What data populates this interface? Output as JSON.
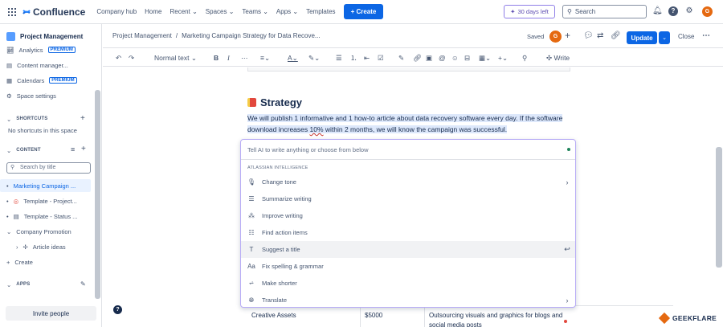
{
  "topbar": {
    "app_name": "Confluence",
    "nav": [
      "Company hub",
      "Home",
      "Recent",
      "Spaces",
      "Teams",
      "Apps",
      "Templates"
    ],
    "create_label": "Create",
    "trial_label": "30 days left",
    "search_placeholder": "Search"
  },
  "sidebar": {
    "space_name": "Project Management",
    "items": [
      {
        "label": "Analytics",
        "badge": "PREMIUM"
      },
      {
        "label": "Content manager..."
      },
      {
        "label": "Calendars",
        "badge": "PREMIUM"
      },
      {
        "label": "Space settings"
      }
    ],
    "shortcuts_header": "SHORTCUTS",
    "shortcuts_empty": "No shortcuts in this space",
    "content_header": "CONTENT",
    "search_placeholder": "Search by title",
    "tree": [
      {
        "label": "Marketing Campaign ..."
      },
      {
        "label": "Template - Project..."
      },
      {
        "label": "Template - Status ..."
      },
      {
        "label": "Company Promotion"
      },
      {
        "label": "Article ideas"
      }
    ],
    "create_label": "Create",
    "apps_header": "APPS",
    "invite_label": "Invite people"
  },
  "pagehead": {
    "breadcrumb_space": "Project Management",
    "breadcrumb_sep": "/",
    "breadcrumb_page": "Marketing Campaign Strategy for Data Recove...",
    "saved_label": "Saved",
    "update_label": "Update",
    "close_label": "Close"
  },
  "toolbar": {
    "style_label": "Normal text",
    "write_label": "Write"
  },
  "editor": {
    "heading": "Strategy",
    "paragraph_a": "We will publish 1 informative and 1 how-to article about data recovery software every day. If the software download increases ",
    "paragraph_err": "10%",
    "paragraph_b": " within 2 months, we will know the campaign was successful.",
    "table_row": {
      "col1": "Creative Assets",
      "col2": "$5000",
      "col3": "Outsourcing visuals and graphics for blogs and social media posts"
    }
  },
  "ai_panel": {
    "input_placeholder": "Tell AI to write anything or choose from below",
    "section": "ATLASSIAN INTELLIGENCE",
    "items": [
      {
        "label": "Change tone",
        "icon": "mic-icon"
      },
      {
        "label": "Summarize writing",
        "icon": "lines-icon"
      },
      {
        "label": "Improve writing",
        "icon": "wand-icon"
      },
      {
        "label": "Find action items",
        "icon": "checklist-icon"
      },
      {
        "label": "Suggest a title",
        "icon": "title-icon"
      },
      {
        "label": "Fix spelling & grammar",
        "icon": "text-icon"
      },
      {
        "label": "Make shorter",
        "icon": "shorter-icon"
      },
      {
        "label": "Translate",
        "icon": "globe-icon"
      }
    ]
  },
  "watermark": "GEEKFLARE",
  "colors": {
    "brand": "#0c66e4",
    "ai_border": "#b8acf6",
    "avatar": "#e56910"
  }
}
